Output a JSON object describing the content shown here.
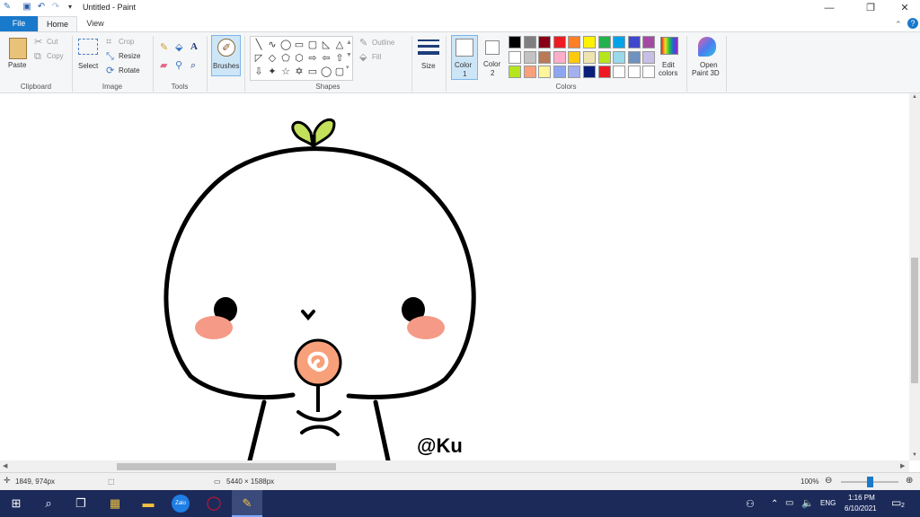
{
  "window": {
    "title": "Untitled - Paint"
  },
  "tabs": {
    "file": "File",
    "home": "Home",
    "view": "View"
  },
  "clipboard": {
    "paste": "Paste",
    "cut": "Cut",
    "copy": "Copy",
    "label": "Clipboard"
  },
  "image": {
    "select": "Select",
    "crop": "Crop",
    "resize": "Resize",
    "rotate": "Rotate",
    "label": "Image"
  },
  "tools": {
    "label": "Tools"
  },
  "brushes": {
    "label": "Brushes"
  },
  "shapes": {
    "outline": "Outline",
    "fill": "Fill",
    "label": "Shapes"
  },
  "size": {
    "label": "Size"
  },
  "colors": {
    "color1": "Color",
    "color1_num": "1",
    "color2": "Color",
    "color2_num": "2",
    "edit_colors": "Edit",
    "edit_colors_2": "colors",
    "label": "Colors",
    "palette_row1": [
      "#000000",
      "#7f7f7f",
      "#880015",
      "#ed1c24",
      "#ff7f27",
      "#fff200",
      "#22b14c",
      "#00a2e8",
      "#3f48cc",
      "#a349a4"
    ],
    "palette_row2": [
      "#ffffff",
      "#c3c3c3",
      "#b97a57",
      "#ffaec9",
      "#ffc90e",
      "#efe4b0",
      "#b5e61d",
      "#99d9ea",
      "#7092be",
      "#c8bfe7"
    ],
    "palette_row3": [
      "#b5e61d",
      "#f8a07a",
      "#fff59a",
      "#8ea6f2",
      "#a2b0f0",
      "#0a1f7a",
      "#ed1c24",
      "#ffffff",
      "#ffffff",
      "#ffffff"
    ]
  },
  "paint3d": {
    "line1": "Open",
    "line2": "Paint 3D"
  },
  "canvas": {
    "watermark": "@Ku"
  },
  "status": {
    "cursor": "1849, 974px",
    "dimensions": "5440 × 1588px",
    "zoom": "100%"
  },
  "clock": {
    "time": "1:16 PM",
    "date": "6/10/2021"
  },
  "tray": {
    "lang": "ENG",
    "notif_count": "2"
  }
}
